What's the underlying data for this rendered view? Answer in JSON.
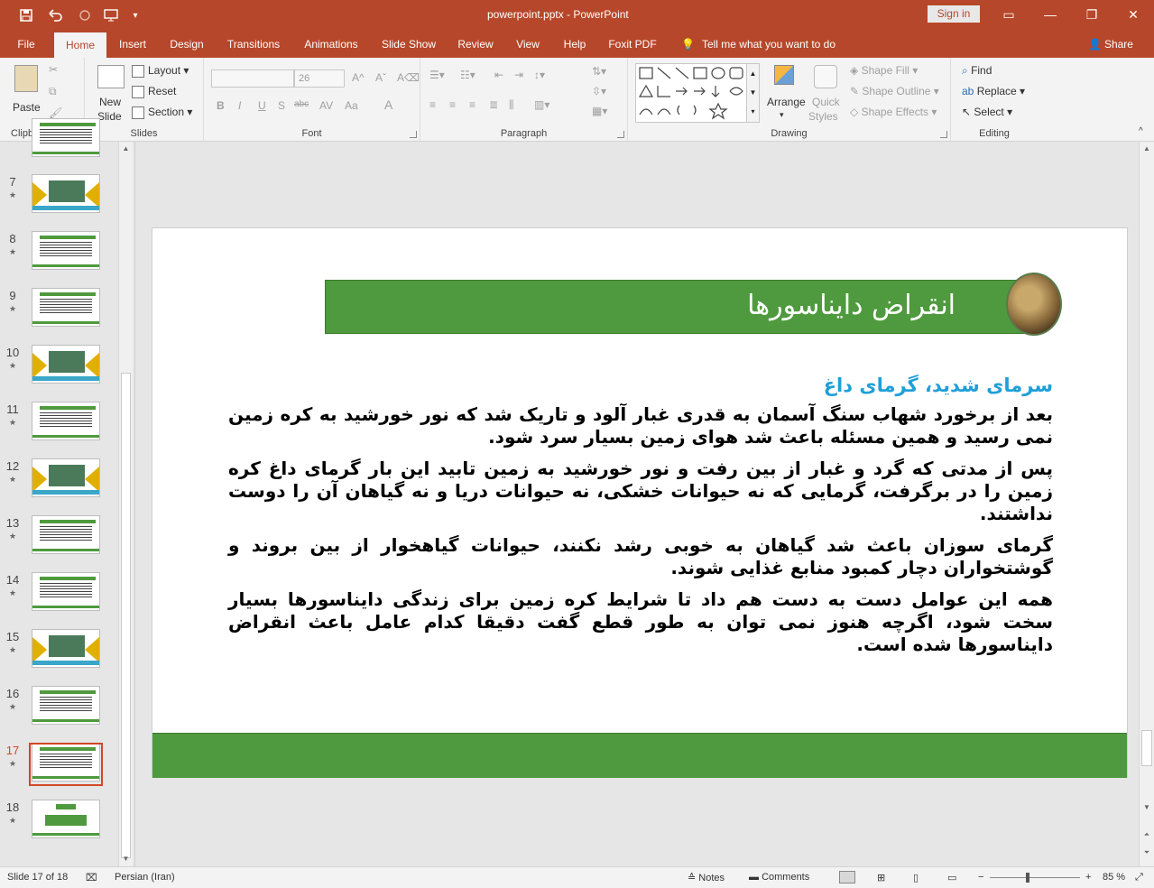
{
  "titlebar": {
    "title": "powerpoint.pptx  -  PowerPoint",
    "signin": "Sign in",
    "qa_icons": [
      "save-icon",
      "undo-icon",
      "redo-icon",
      "present-icon",
      "customize-icon"
    ]
  },
  "tabs": [
    "File",
    "Home",
    "Insert",
    "Design",
    "Transitions",
    "Animations",
    "Slide Show",
    "Review",
    "View",
    "Help",
    "Foxit PDF"
  ],
  "active_tab": "Home",
  "tellme": "Tell me what you want to do",
  "share": "Share",
  "ribbon": {
    "clipboard": {
      "label": "Clipboard",
      "paste": "Paste"
    },
    "slides": {
      "label": "Slides",
      "new_slide_1": "New",
      "new_slide_2": "Slide",
      "layout": "Layout",
      "reset": "Reset",
      "section": "Section"
    },
    "font": {
      "label": "Font",
      "size": "26",
      "bold": "B",
      "italic": "I",
      "underline": "U",
      "shadow": "S",
      "strike": "abc",
      "spacing": "AV",
      "case": "Aa",
      "color": "A"
    },
    "paragraph": {
      "label": "Paragraph"
    },
    "drawing": {
      "label": "Drawing",
      "arrange": "Arrange",
      "quick_styles_1": "Quick",
      "quick_styles_2": "Styles",
      "shape_fill": "Shape Fill",
      "shape_outline": "Shape Outline",
      "shape_effects": "Shape Effects"
    },
    "editing": {
      "label": "Editing",
      "find": "Find",
      "replace": "Replace",
      "select": "Select"
    }
  },
  "thumbnails": [
    {
      "num": "7",
      "kind": "picture"
    },
    {
      "num": "8",
      "kind": "text"
    },
    {
      "num": "9",
      "kind": "text"
    },
    {
      "num": "10",
      "kind": "picture"
    },
    {
      "num": "11",
      "kind": "text"
    },
    {
      "num": "12",
      "kind": "picture"
    },
    {
      "num": "13",
      "kind": "text"
    },
    {
      "num": "14",
      "kind": "text"
    },
    {
      "num": "15",
      "kind": "picture"
    },
    {
      "num": "16",
      "kind": "text"
    },
    {
      "num": "17",
      "kind": "text"
    },
    {
      "num": "18",
      "kind": "end"
    }
  ],
  "current_slide": "17",
  "slide": {
    "title": "انقراض دایناسورها",
    "subhead": "سرمای شدید، گرمای داغ",
    "paragraphs": [
      "بعد از برخورد شهاب سنگ آسمان به قدری غبار آلود و تاریک شد که نور خورشید به کره زمین نمی رسید و همین مسئله باعث شد هوای زمین بسیار سرد شود.",
      "پس از مدتی که گرد و غبار از بین رفت و نور خورشید به زمین تابید این بار گرمای داغ کره زمین را در برگرفت، گرمایی که نه حیوانات خشکی، نه حیوانات دریا و نه گیاهان آن را دوست نداشتند.",
      "گرمای سوزان باعث شد گیاهان به خوبی رشد نکنند، حیوانات گیاهخوار از بین بروند و گوشتخواران دچار کمبود منابع غذایی شوند.",
      "همه این عوامل دست به دست هم داد تا شرایط کره زمین برای زندگی دایناسورها بسیار سخت شود، اگرچه هنوز نمی توان به طور قطع گفت دقیقا کدام عامل باعث انقراض دایناسورها شده است."
    ],
    "colors": {
      "band": "#4f9a3e",
      "subhead": "#1fa0d8"
    }
  },
  "status": {
    "slide_of": "Slide 17 of 18",
    "language": "Persian (Iran)",
    "notes": "Notes",
    "comments": "Comments",
    "zoom_minus": "−",
    "zoom_plus": "+",
    "zoom": "85 %"
  }
}
